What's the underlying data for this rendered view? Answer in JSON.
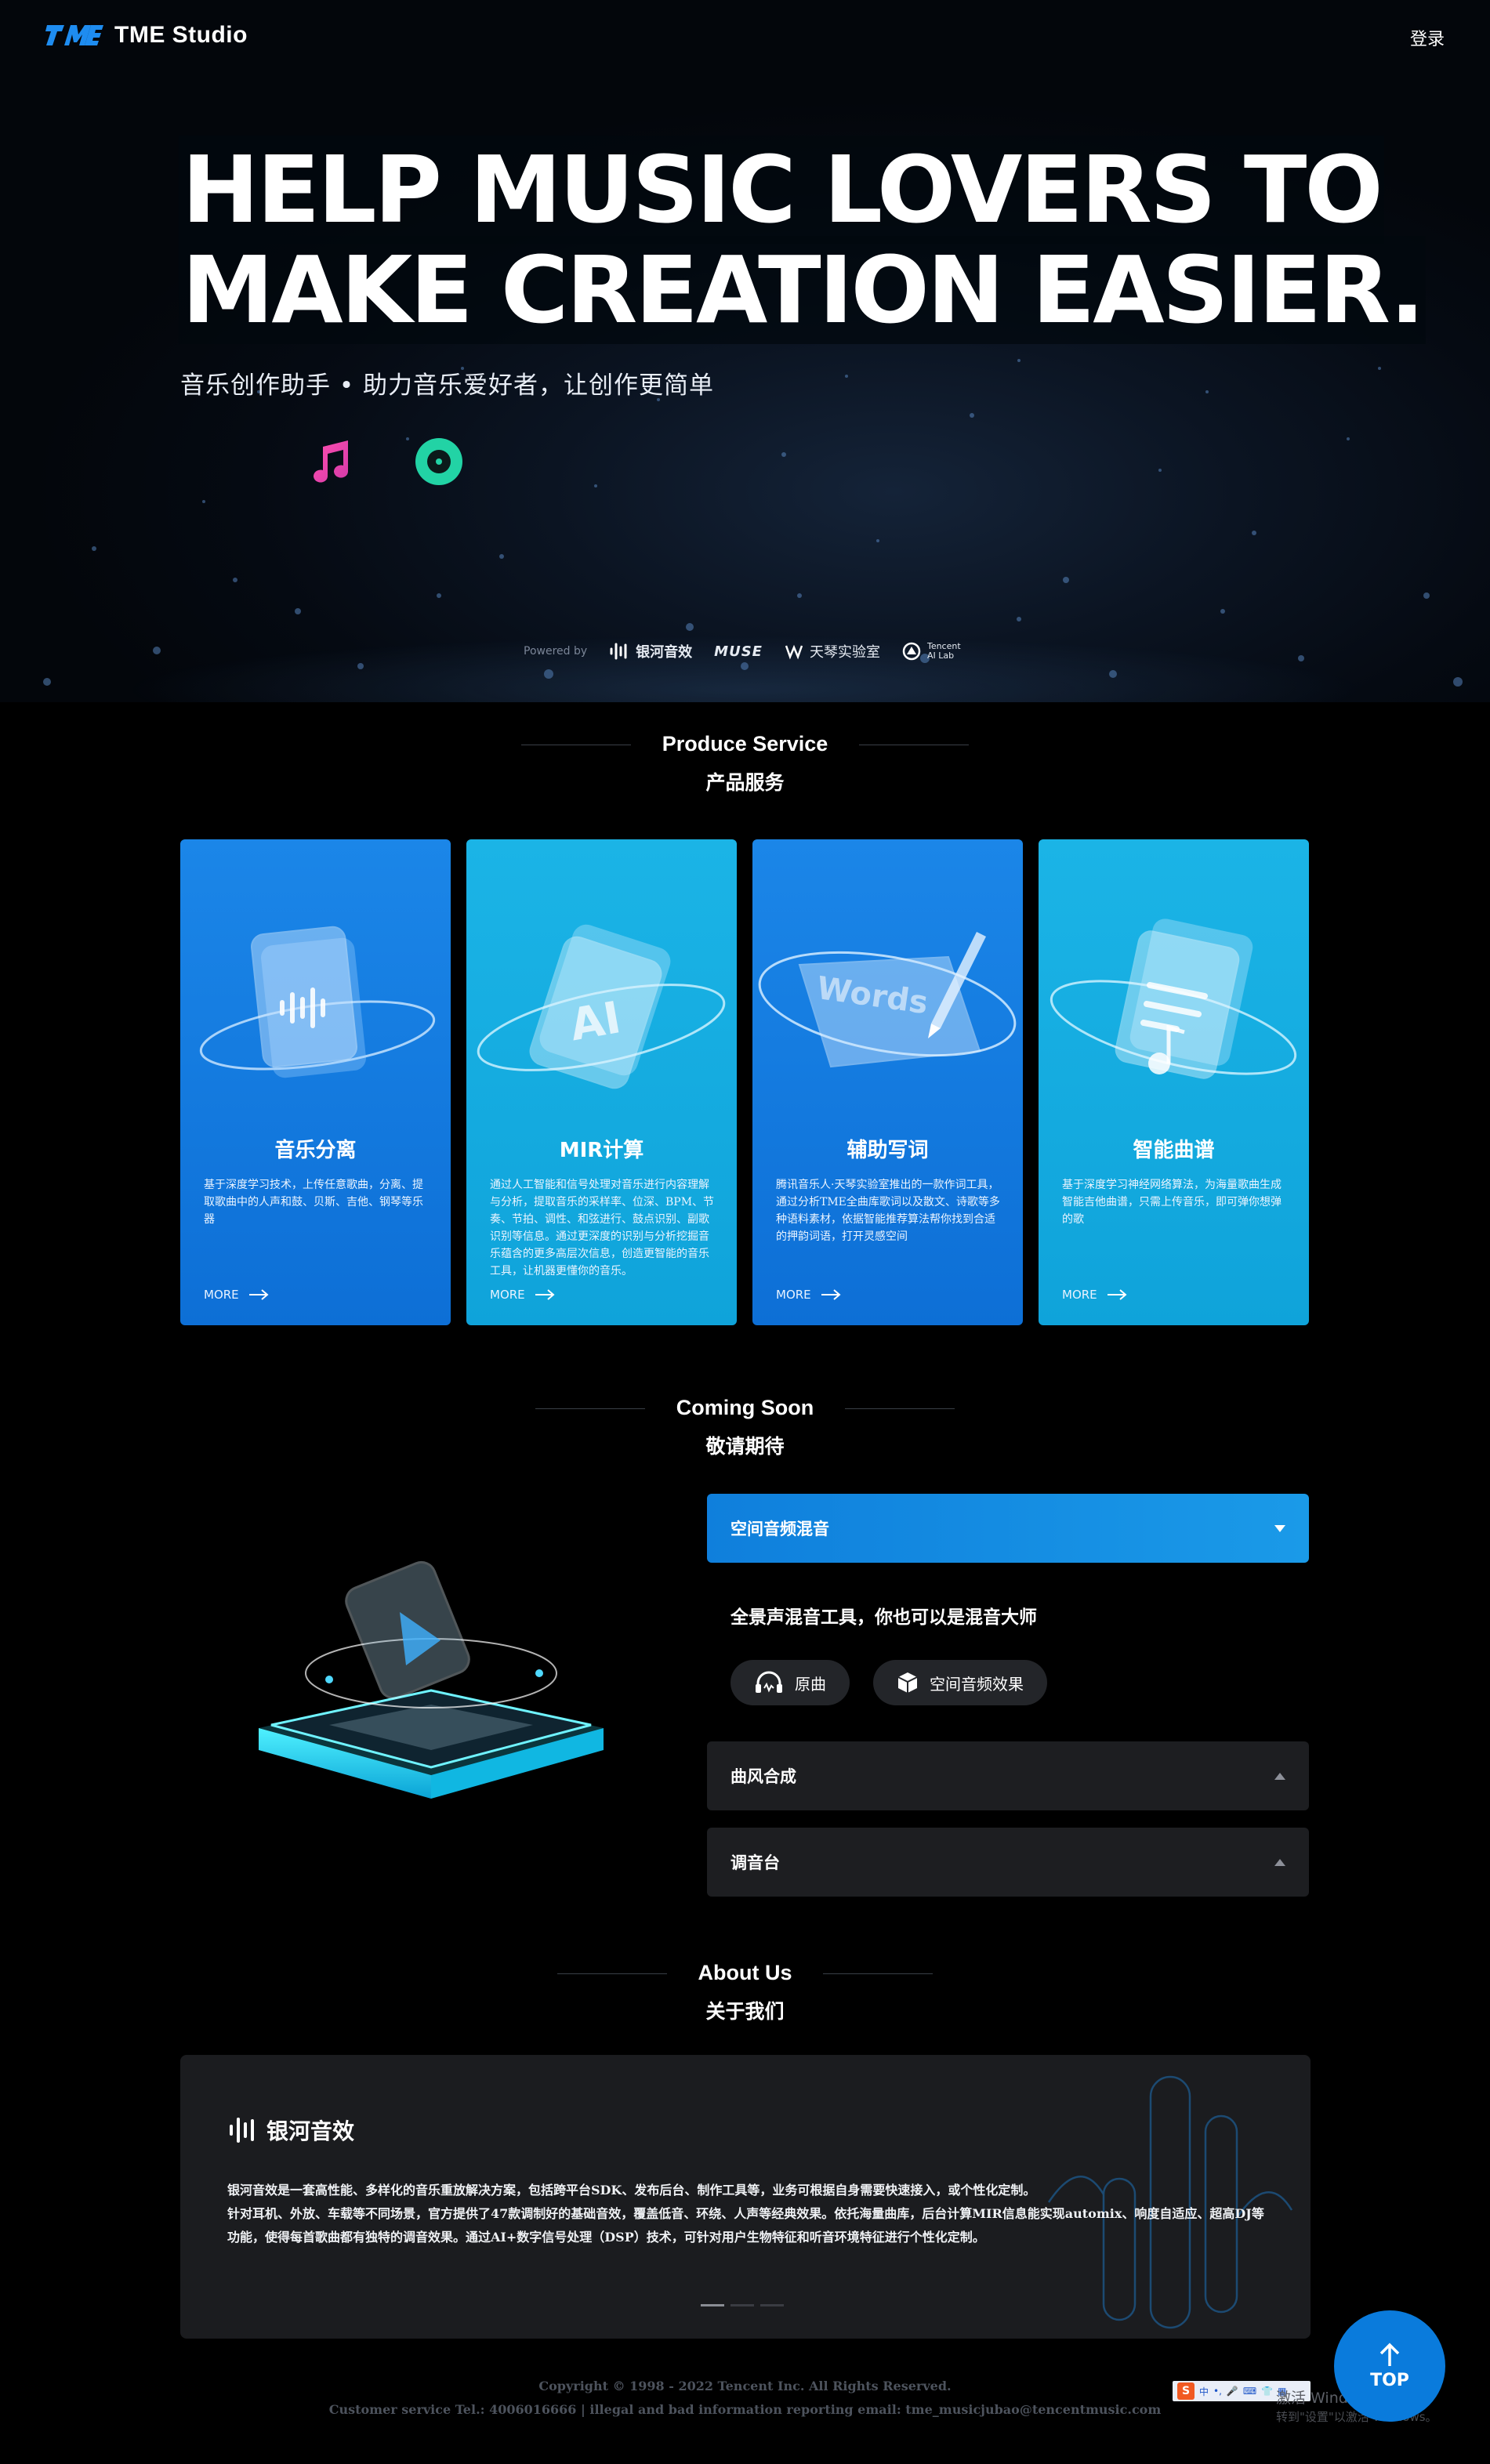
{
  "header": {
    "brand": "TME Studio",
    "login": "登录"
  },
  "hero": {
    "headline_line1": "HELP MUSIC LOVERS TO",
    "headline_line2": "MAKE CREATION EASIER.",
    "subtitle": "音乐创作助手 • 助力音乐爱好者，让创作更简单",
    "icons": [
      "waveform-icon",
      "music-note-icon",
      "vinyl-disc-icon"
    ],
    "powered_label": "Powered by",
    "partners": [
      {
        "name": "银河音效",
        "icon": "galaxy-audio-logo"
      },
      {
        "name": "MUSE",
        "icon": "muse-logo"
      },
      {
        "name": "天琴实验室",
        "icon": "tianqin-lab-logo"
      },
      {
        "name": "Tencent AI Lab",
        "icon": "tencent-ai-lab-logo"
      }
    ]
  },
  "services": {
    "title_en": "Produce Service",
    "title_zh": "产品服务",
    "more_label": "MORE",
    "cards": [
      {
        "title": "音乐分离",
        "desc": "基于深度学习技术，上传任意歌曲，分离、提取歌曲中的人声和鼓、贝斯、吉他、钢琴等乐器",
        "color": "#1b86e8"
      },
      {
        "title": "MIR计算",
        "desc": "通过人工智能和信号处理对音乐进行内容理解与分析，提取音乐的采样率、位深、BPM、节奏、节拍、调性、和弦进行、鼓点识别、副歌识别等信息。通过更深度的识别与分析挖掘音乐蕴含的更多高层次信息，创造更智能的音乐工具，让机器更懂你的音乐。",
        "color": "#1bb4e6"
      },
      {
        "title": "辅助写词",
        "desc": "腾讯音乐人·天琴实验室推出的一款作词工具，通过分析TME全曲库歌词以及散文、诗歌等多种语料素材，依据智能推荐算法帮你找到合适的押韵词语，打开灵感空间",
        "color": "#1b86e8"
      },
      {
        "title": "智能曲谱",
        "desc": "基于深度学习神经网络算法，为海量歌曲生成智能吉他曲谱，只需上传音乐，即可弹你想弹的歌",
        "color": "#1bb4e6"
      }
    ]
  },
  "coming_soon": {
    "title_en": "Coming Soon",
    "title_zh": "敬请期待",
    "accordion": [
      {
        "label": "空间音频混音",
        "expanded": true
      },
      {
        "label": "曲风合成",
        "expanded": false
      },
      {
        "label": "调音台",
        "expanded": false
      }
    ],
    "active_tagline": "全景声混音工具，你也可以是混音大师",
    "buttons": [
      {
        "label": "原曲",
        "icon": "headphones-icon"
      },
      {
        "label": "空间音频效果",
        "icon": "cube-icon"
      }
    ]
  },
  "about": {
    "title_en": "About Us",
    "title_zh": "关于我们",
    "brand": "银河音效",
    "text_line1": "银河音效是一套高性能、多样化的音乐重放解决方案，包括跨平台SDK、发布后台、制作工具等，业务可根据自身需要快速接入，或个性化定制。",
    "text_line2": "针对耳机、外放、车载等不同场景，官方提供了47款调制好的基础音效，覆盖低音、环绕、人声等经典效果。依托海量曲库，后台计算MIR信息能实现automix、响度自适应、超高DJ等",
    "text_line3": "功能，使得每首歌曲都有独特的调音效果。通过AI+数字信号处理（DSP）技术，可针对用户生物特征和听音环境特征进行个性化定制。"
  },
  "footer": {
    "copyright": "Copyright © 1998 - 2022 Tencent Inc. All Rights Reserved.",
    "contact": "Customer service Tel.: 4006016666 | illegal and bad information reporting email: tme_musicjubao@tencentmusic.com",
    "top_label": "TOP"
  },
  "system_overlay": {
    "ime_label": "中",
    "watermark_title": "激活 Windows",
    "watermark_sub": "转到\"设置\"以激活 Windows。"
  },
  "colors": {
    "accent_blue": "#0d6fd6",
    "accent_cyan": "#0fa3da",
    "top_button": "#0a7bdc",
    "panel": "#1b1c1f"
  }
}
